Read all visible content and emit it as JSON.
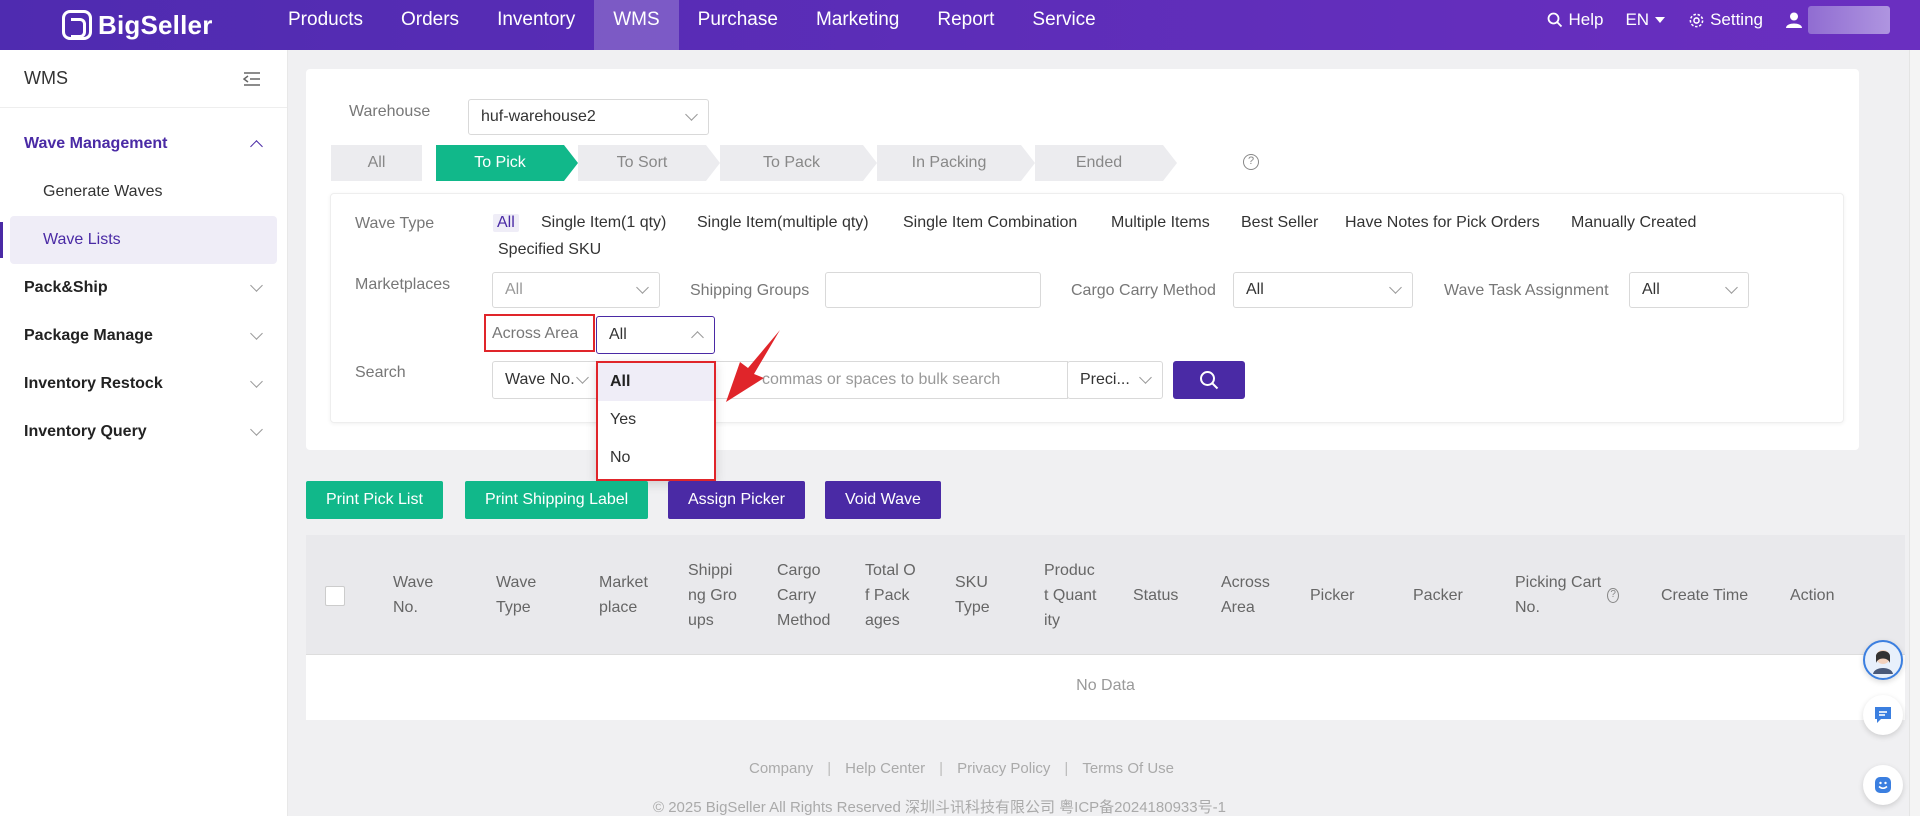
{
  "app": {
    "logo": "BigSeller"
  },
  "nav": {
    "items": [
      "Products",
      "Orders",
      "Inventory",
      "WMS",
      "Purchase",
      "Marketing",
      "Report",
      "Service"
    ],
    "active": "WMS",
    "help": "Help",
    "lang": "EN",
    "setting": "Setting"
  },
  "sidebar": {
    "title": "WMS",
    "groups": [
      {
        "label": "Wave Management",
        "expanded": true,
        "children": [
          "Generate Waves",
          "Wave Lists"
        ],
        "active_child": "Wave Lists"
      },
      {
        "label": "Pack&Ship"
      },
      {
        "label": "Package Manage"
      },
      {
        "label": "Inventory Restock"
      },
      {
        "label": "Inventory Query"
      }
    ]
  },
  "filters": {
    "warehouse_label": "Warehouse",
    "warehouse_value": "huf-warehouse2",
    "steps": [
      "All",
      "To Pick",
      "To Sort",
      "To Pack",
      "In Packing",
      "Ended"
    ],
    "active_step": "To Pick",
    "wave_type_label": "Wave Type",
    "wave_types": [
      "All",
      "Single Item(1 qty)",
      "Single Item(multiple qty)",
      "Single Item Combination",
      "Multiple Items",
      "Best Seller",
      "Have Notes for Pick Orders",
      "Manually Created",
      "Specified SKU"
    ],
    "marketplaces_label": "Marketplaces",
    "marketplaces_value": "All",
    "shipping_groups_label": "Shipping Groups",
    "cargo_label": "Cargo Carry Method",
    "cargo_value": "All",
    "task_label": "Wave Task Assignment",
    "task_value": "All",
    "across_label": "Across Area",
    "across_value": "All",
    "across_options": [
      "All",
      "Yes",
      "No"
    ],
    "search_label": "Search",
    "search_field": "Wave No.",
    "search_placeholder_visible": "commas or spaces to bulk search",
    "search_mode": "Preci..."
  },
  "actions": [
    "Print Pick List",
    "Print Shipping Label",
    "Assign Picker",
    "Void Wave"
  ],
  "table": {
    "columns": [
      "Wave No.",
      "Wave Type",
      "Marketplace",
      "Shipping Groups",
      "Cargo Carry Method",
      "Total Of Packages",
      "SKU Type",
      "Product Quantity",
      "Status",
      "Across Area",
      "Picker",
      "Packer",
      "Picking Cart No.",
      "Create Time",
      "Action"
    ],
    "empty": "No Data"
  },
  "footer": {
    "links": [
      "Company",
      "Help Center",
      "Privacy Policy",
      "Terms Of Use"
    ],
    "copyright": "© 2025 BigSeller All Rights Reserved   深圳斗讯科技有限公司   粤ICP备2024180933号-1"
  },
  "colors": {
    "brand": "#4a2aa5",
    "green": "#11b88a",
    "alert_red": "#e0252a"
  }
}
